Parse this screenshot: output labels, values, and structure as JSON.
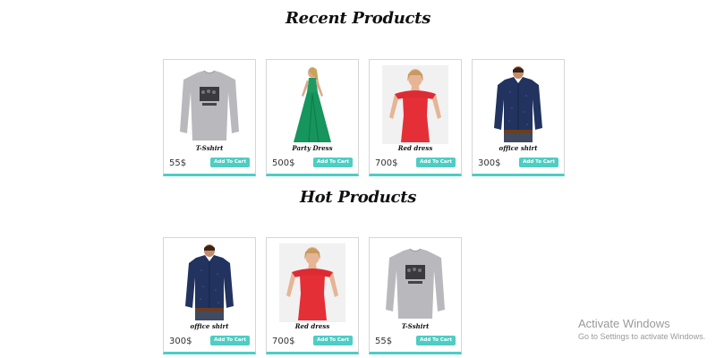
{
  "recent": {
    "title": "Recent Products",
    "products": [
      {
        "name": "T-Sshirt",
        "price": "55$",
        "button": "Add To Cart",
        "image": "tshirt-image"
      },
      {
        "name": "Party Dress",
        "price": "500$",
        "button": "Add To Cart",
        "image": "green-dress-image"
      },
      {
        "name": "Red dress",
        "price": "700$",
        "button": "Add To Cart",
        "image": "red-dress-image"
      },
      {
        "name": "office shirt",
        "price": "300$",
        "button": "Add To Cart",
        "image": "office-shirt-image"
      }
    ]
  },
  "hot": {
    "title": "Hot Products",
    "products": [
      {
        "name": "office shirt",
        "price": "300$",
        "button": "Add To Cart",
        "image": "office-shirt-image"
      },
      {
        "name": "Red dress",
        "price": "700$",
        "button": "Add To Cart",
        "image": "red-dress-image"
      },
      {
        "name": "T-Sshirt",
        "price": "55$",
        "button": "Add To Cart",
        "image": "tshirt-image"
      }
    ]
  },
  "watermark": {
    "title": "Activate Windows",
    "subtitle": "Go to Settings to activate Windows."
  },
  "colors": {
    "accent": "#4ecdc4",
    "card_border": "#d6d6d6"
  }
}
